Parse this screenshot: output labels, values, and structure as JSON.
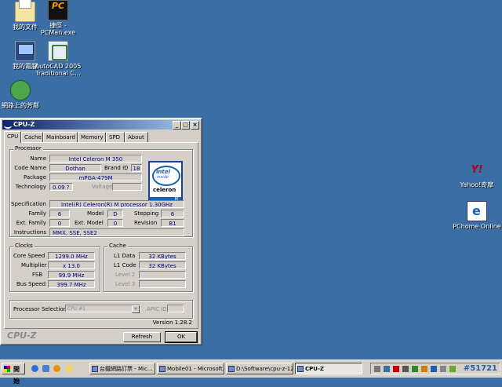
{
  "desktop": {
    "icons": [
      {
        "label": "我的文件",
        "icon": "documents-icon"
      },
      {
        "label": "我的電腦",
        "icon": "computer-icon"
      },
      {
        "label": "網路上的芳鄰",
        "icon": "network-icon"
      },
      {
        "label": "捷徑 -",
        "label2": "PCMan.exe",
        "icon": "pcman-icon"
      },
      {
        "label": "AutoCAD 2005",
        "label2": "Traditional C...",
        "icon": "autocad-icon"
      },
      {
        "label": "Yahoo!奇摩",
        "icon": "yahoo-icon"
      },
      {
        "label": "PChome Online",
        "icon": "pchome-icon"
      }
    ]
  },
  "window": {
    "title": "CPU-Z",
    "controls": {
      "minimize": "_",
      "maximize": "□",
      "close": "×"
    },
    "tabs": [
      "CPU",
      "Cache",
      "Mainboard",
      "Memory",
      "SPD",
      "About"
    ],
    "active_tab": "CPU",
    "processor": {
      "group_title": "Processor",
      "labels": {
        "name": "Name",
        "code_name": "Code Name",
        "brand_id": "Brand ID",
        "package": "Package",
        "technology": "Technology",
        "voltage": "Voltage",
        "specification": "Specification",
        "family": "Family",
        "model": "Model",
        "stepping": "Stepping",
        "ext_family": "Ext. Family",
        "ext_model": "Ext. Model",
        "revision": "Revision",
        "instructions": "Instructions"
      },
      "values": {
        "name": "Intel Celeron M 350",
        "code_name": "Dothan",
        "brand_id": "18",
        "package": "mPGA-479M",
        "technology": "0.09 ?",
        "voltage": "",
        "specification": "Intel(R) Celeron(R) M processor       1.30GHz",
        "family": "6",
        "model": "D",
        "stepping": "6",
        "ext_family": "0",
        "ext_model": "0",
        "revision": "B1",
        "instructions": "MMX, SSE, SSE2"
      },
      "logo": {
        "line1": "intel",
        "line2": "inside",
        "line3": "celeron",
        "line4": "M"
      }
    },
    "clocks": {
      "group_title": "Clocks",
      "labels": {
        "core_speed": "Core Speed",
        "multiplier": "Multiplier",
        "fsb": "FSB",
        "bus_speed": "Bus Speed"
      },
      "values": {
        "core_speed": "1299.0 MHz",
        "multiplier": "x 13.0",
        "fsb": "99.9 MHz",
        "bus_speed": "399.7 MHz"
      }
    },
    "cache": {
      "group_title": "Cache",
      "labels": {
        "l1_data": "L1 Data",
        "l1_code": "L1 Code",
        "level2": "Level 2",
        "level3": "Level 3"
      },
      "values": {
        "l1_data": "32 KBytes",
        "l1_code": "32 KBytes",
        "level2": "",
        "level3": ""
      }
    },
    "selection": {
      "label": "Processor Selection",
      "value": "CPU #1",
      "apic_label": "APIC ID"
    },
    "version": "Version 1.28.2",
    "brand": "CPU-Z",
    "refresh_label": "Refresh",
    "ok_label": "OK"
  },
  "taskbar": {
    "start_label": "開始",
    "tasks": [
      {
        "label": "台鐵網路訂票 - Mic..."
      },
      {
        "label": "Mobile01 - Microsoft..."
      },
      {
        "label": "D:\\Software\\cpu-z-128"
      },
      {
        "label": "CPU-Z",
        "active": true
      }
    ],
    "clock": "#51721"
  }
}
